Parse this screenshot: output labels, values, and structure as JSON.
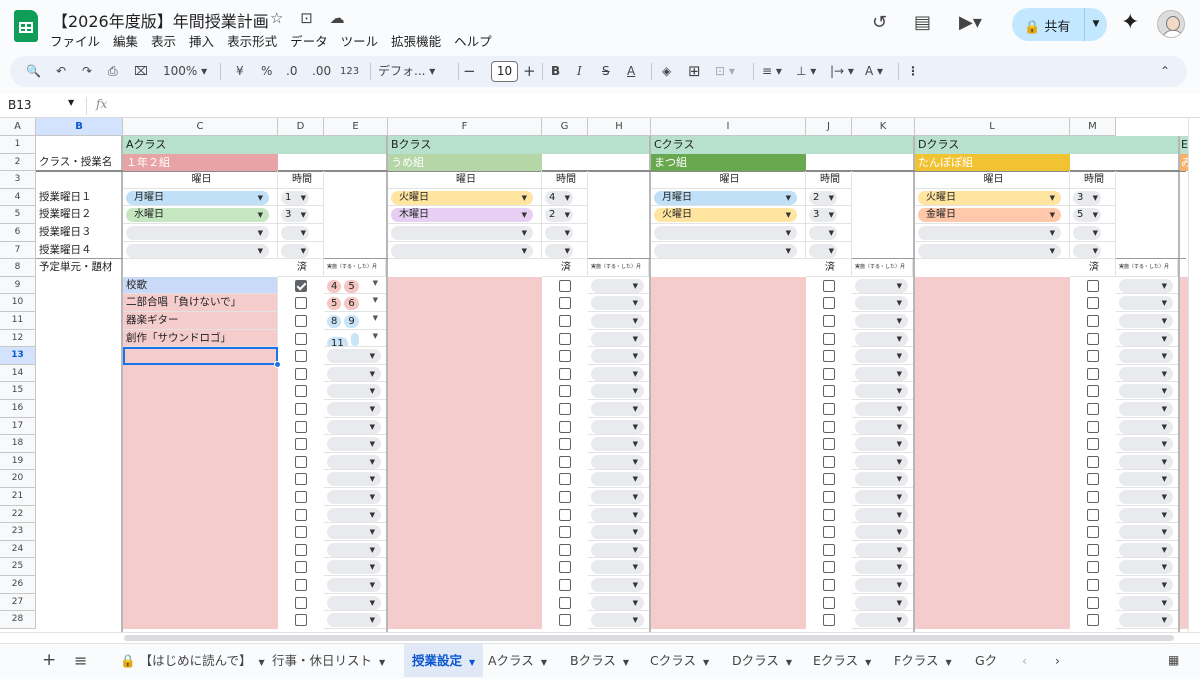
{
  "app": {
    "title": "【2026年度版】年間授業計画",
    "menus": [
      "ファイル",
      "編集",
      "表示",
      "挿入",
      "表示形式",
      "データ",
      "ツール",
      "拡張機能",
      "ヘルプ"
    ],
    "share_label": "共有"
  },
  "toolbar": {
    "zoom": "100%",
    "currency": "¥",
    "percent": "%",
    "dec_less": ".0",
    "dec_more": ".00",
    "number_format": "123",
    "font": "デフォ...",
    "font_size": "10"
  },
  "formula_bar": {
    "name_box": "B13",
    "fx": "fx",
    "value": ""
  },
  "grid": {
    "columns": [
      "A",
      "B",
      "C",
      "D",
      "E",
      "F",
      "G",
      "H",
      "I",
      "J",
      "K",
      "L",
      "M"
    ],
    "rows": [
      "1",
      "2",
      "3",
      "4",
      "5",
      "6",
      "7",
      "8",
      "9",
      "10",
      "11",
      "12",
      "13",
      "14",
      "15",
      "16",
      "17",
      "18",
      "19",
      "20",
      "21",
      "22",
      "23",
      "24",
      "25",
      "26",
      "27",
      "28"
    ],
    "selected_cell": "B13",
    "row_labels": {
      "r2": "クラス・授業名",
      "r4": "授業曜日１",
      "r5": "授業曜日２",
      "r6": "授業曜日３",
      "r7": "授業曜日４",
      "r8": "予定単元・題材"
    },
    "headers": {
      "day": "曜日",
      "time": "時間",
      "done": "済",
      "impl": "実施（する・した）月"
    },
    "classes": [
      {
        "name": "Aクラス",
        "group": "１年２組",
        "group_color": "#e8a3a6",
        "days": [
          "月曜日",
          "水曜日"
        ],
        "day_colors": [
          "#bfe0f6",
          "#c6e6c2"
        ],
        "times": [
          "1",
          "3"
        ]
      },
      {
        "name": "Bクラス",
        "group": "うめ組",
        "group_color": "#b5d7a8",
        "days": [
          "火曜日",
          "木曜日"
        ],
        "day_colors": [
          "#ffe5a0",
          "#e6cff2"
        ],
        "times": [
          "4",
          "2"
        ]
      },
      {
        "name": "Cクラス",
        "group": "まつ組",
        "group_color": "#6aa84f",
        "days": [
          "月曜日",
          "火曜日"
        ],
        "day_colors": [
          "#bfe0f6",
          "#ffe5a0"
        ],
        "times": [
          "2",
          "3"
        ]
      },
      {
        "name": "Dクラス",
        "group": "たんぽぽ組",
        "group_color": "#f1c232",
        "days": [
          "火曜日",
          "金曜日"
        ],
        "day_colors": [
          "#ffe5a0",
          "#ffc8aa"
        ],
        "times": [
          "3",
          "5"
        ]
      }
    ],
    "partial_class": {
      "name": "E",
      "group": "み"
    },
    "units": [
      {
        "title": "校歌",
        "done": true,
        "months": [
          "4",
          "5"
        ],
        "month_color": "#f4c7c3",
        "highlight": true
      },
      {
        "title": "二部合唱「負けないで」",
        "done": false,
        "months": [
          "5",
          "6"
        ],
        "month_color": "#f4c7c3",
        "highlight": false
      },
      {
        "title": "器楽ギター",
        "done": false,
        "months": [
          "8",
          "9"
        ],
        "month_color": "#c9e4f7",
        "highlight": false
      },
      {
        "title": "創作「サウンドロゴ」",
        "done": false,
        "months": [
          "11",
          ""
        ],
        "month_color": "#c9e4f7",
        "highlight": false
      }
    ]
  },
  "sheet_tabs": [
    {
      "label": "【はじめに読んで】",
      "locked": true,
      "active": false
    },
    {
      "label": "行事・休日リスト",
      "locked": false,
      "active": false
    },
    {
      "label": "授業設定",
      "locked": false,
      "active": true
    },
    {
      "label": "Aクラス",
      "locked": false,
      "active": false
    },
    {
      "label": "Bクラス",
      "locked": false,
      "active": false
    },
    {
      "label": "Cクラス",
      "locked": false,
      "active": false
    },
    {
      "label": "Dクラス",
      "locked": false,
      "active": false
    },
    {
      "label": "Eクラス",
      "locked": false,
      "active": false
    },
    {
      "label": "Fクラス",
      "locked": false,
      "active": false
    },
    {
      "label": "Gク",
      "locked": false,
      "active": false
    }
  ],
  "colors": {
    "pink_area": "#f4cccc",
    "class_header": "#b7e1cd",
    "selection": "#1a73e8"
  }
}
